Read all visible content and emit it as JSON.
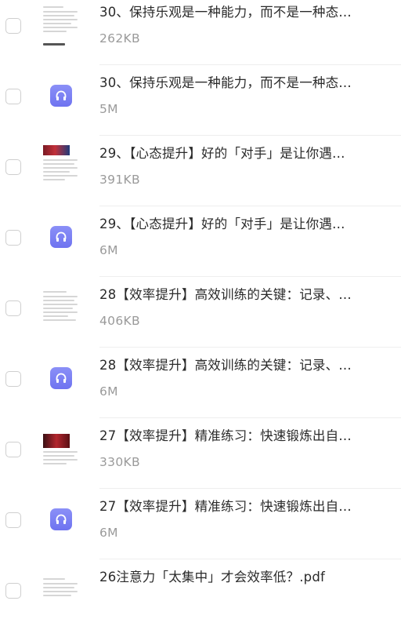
{
  "files": [
    {
      "name": "30、保持乐观是一种能力，而不是一种态…",
      "size": "262KB",
      "type": "doc",
      "thumb_style": "plain"
    },
    {
      "name": "30、保持乐观是一种能力，而不是一种态…",
      "size": "5M",
      "type": "audio"
    },
    {
      "name": "29、【心态提升】好的「对手」是让你遇…",
      "size": "391KB",
      "type": "doc",
      "thumb_style": "image-red"
    },
    {
      "name": "29、【心态提升】好的「对手」是让你遇…",
      "size": "6M",
      "type": "audio"
    },
    {
      "name": "28【效率提升】高效训练的关键：记录、…",
      "size": "406KB",
      "type": "doc",
      "thumb_style": "plain"
    },
    {
      "name": "28【效率提升】高效训练的关键：记录、…",
      "size": "6M",
      "type": "audio"
    },
    {
      "name": "27【效率提升】精准练习：快速锻炼出自…",
      "size": "330KB",
      "type": "doc",
      "thumb_style": "image-red"
    },
    {
      "name": "27【效率提升】精准练习：快速锻炼出自…",
      "size": "6M",
      "type": "audio"
    },
    {
      "name": "26注意力「太集中」才会效率低？.pdf",
      "size": "",
      "type": "doc",
      "thumb_style": "plain"
    }
  ],
  "colors": {
    "audio_icon": "#7b7ff3",
    "name_text": "#2a2a2a",
    "size_text": "#9a9a9a"
  },
  "icons": {
    "audio": "headphones-icon",
    "doc": "document-thumbnail"
  }
}
